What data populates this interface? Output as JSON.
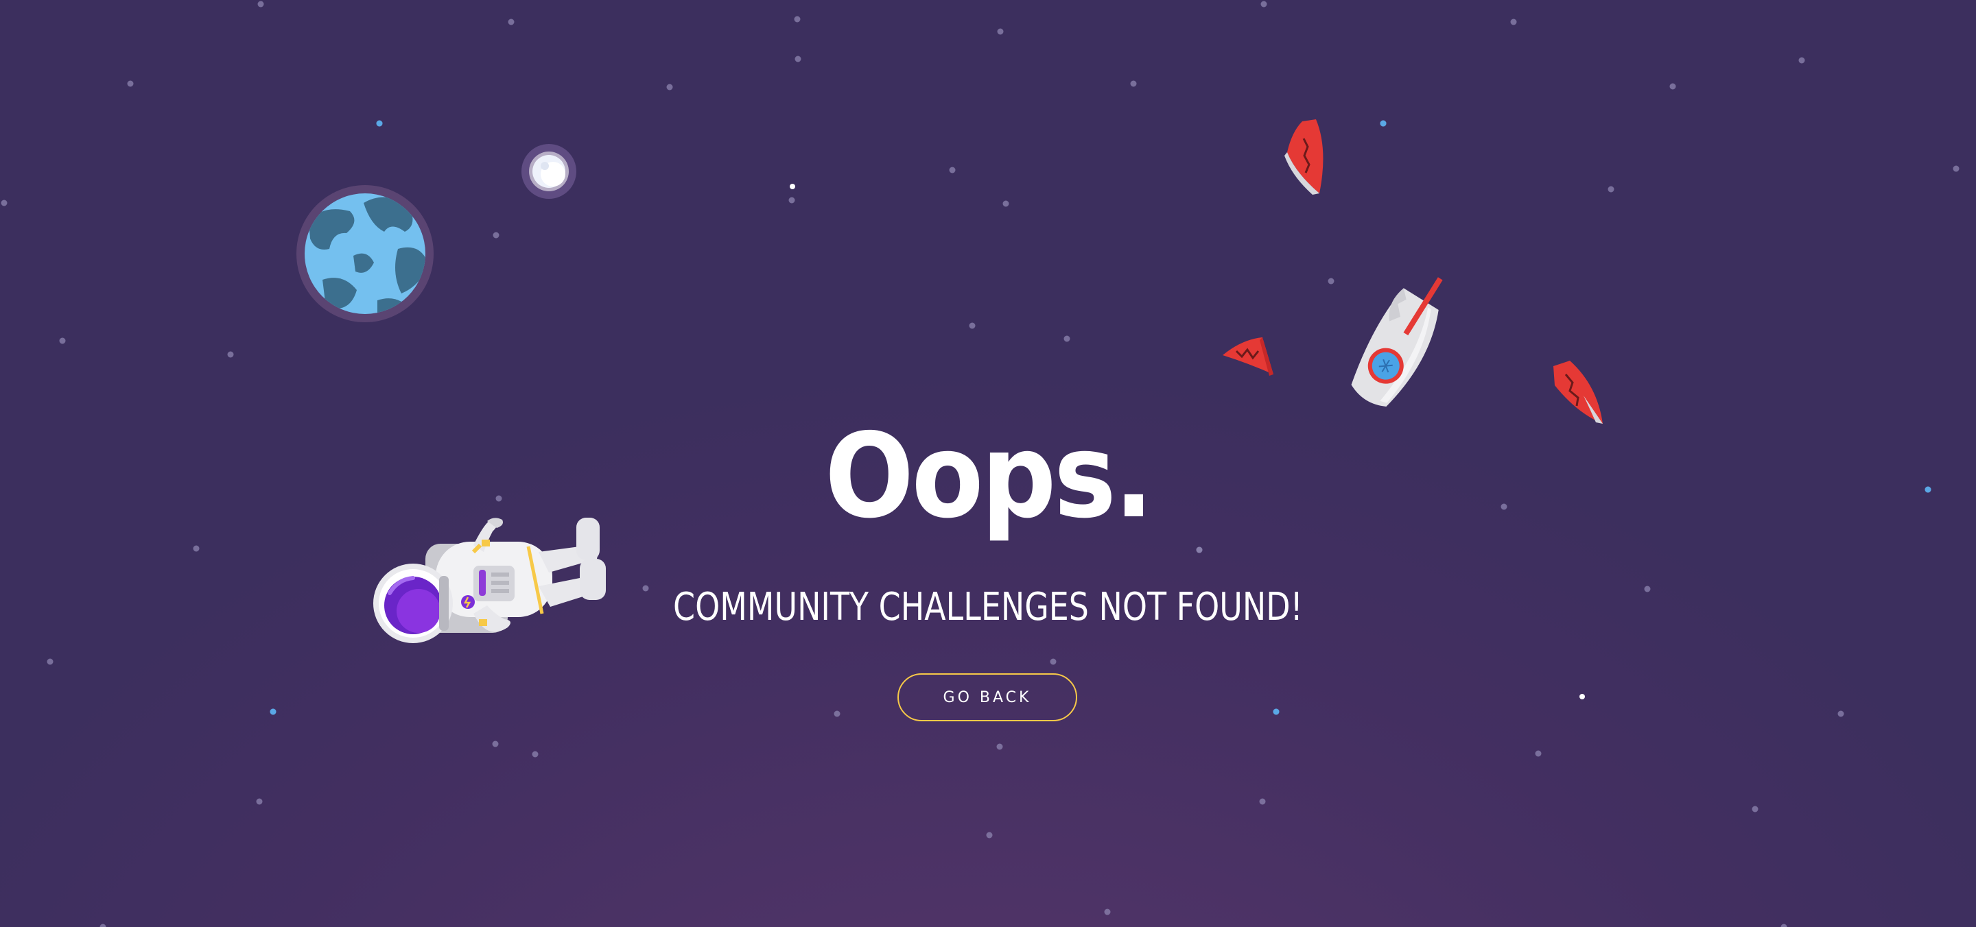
{
  "page": {
    "title": "Oops.",
    "subtitle": "COMMUNITY CHALLENGES NOT FOUND!",
    "button_label": "GO BACK"
  },
  "illustrations": {
    "planet": "earth-planet-icon",
    "moon": "moon-icon",
    "astronaut": "astronaut-icon",
    "rocket": "broken-rocket-icon",
    "debris": "rocket-debris-icon"
  },
  "colors": {
    "background_top": "#3c2f5e",
    "background_bottom": "#58376b",
    "button_border": "#f7c948",
    "text": "#ffffff",
    "rocket_accent": "#e53935",
    "planet_water": "#6fbfee",
    "planet_land": "#3b6c8c",
    "astronaut_visor": "#7b2fd8"
  }
}
